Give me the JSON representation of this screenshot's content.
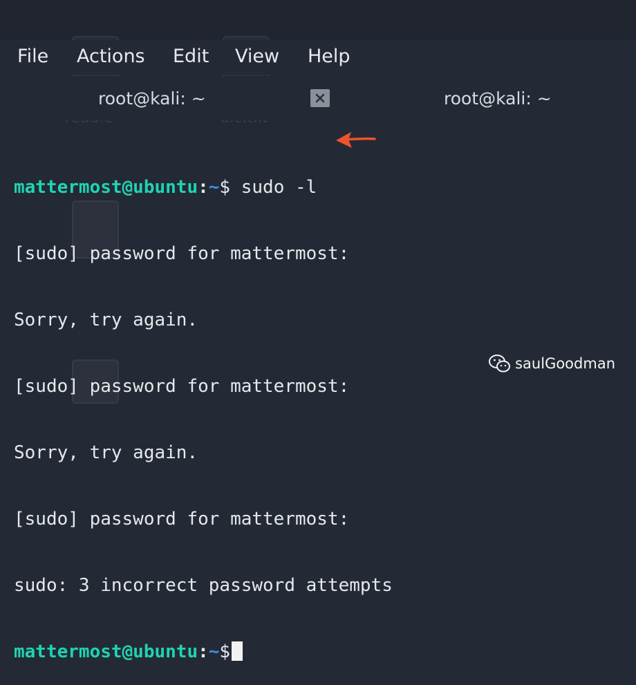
{
  "menu": {
    "items": [
      "File",
      "Actions",
      "Edit",
      "View",
      "Help"
    ]
  },
  "tabs": [
    {
      "title": "root@kali: ~"
    },
    {
      "title": "root@kali: ~"
    }
  ],
  "background_desktop": {
    "icon_labels": [
      "read.c",
      "dic.txt"
    ]
  },
  "terminal": {
    "prompt_user": "mattermost@ubuntu",
    "prompt_sep": ":",
    "prompt_path": "~",
    "prompt_dollar": "$",
    "command": " sudo -l",
    "output": [
      "[sudo] password for mattermost:",
      "Sorry, try again.",
      "[sudo] password for mattermost:",
      "Sorry, try again.",
      "[sudo] password for mattermost:",
      "sudo: 3 incorrect password attempts"
    ]
  },
  "annotation": {
    "arrow_color": "#f0532b"
  },
  "watermark": {
    "text": "saulGoodman"
  },
  "colors": {
    "background": "#242a35",
    "prompt_user": "#1fd3b3",
    "prompt_path": "#3a8ee6"
  }
}
